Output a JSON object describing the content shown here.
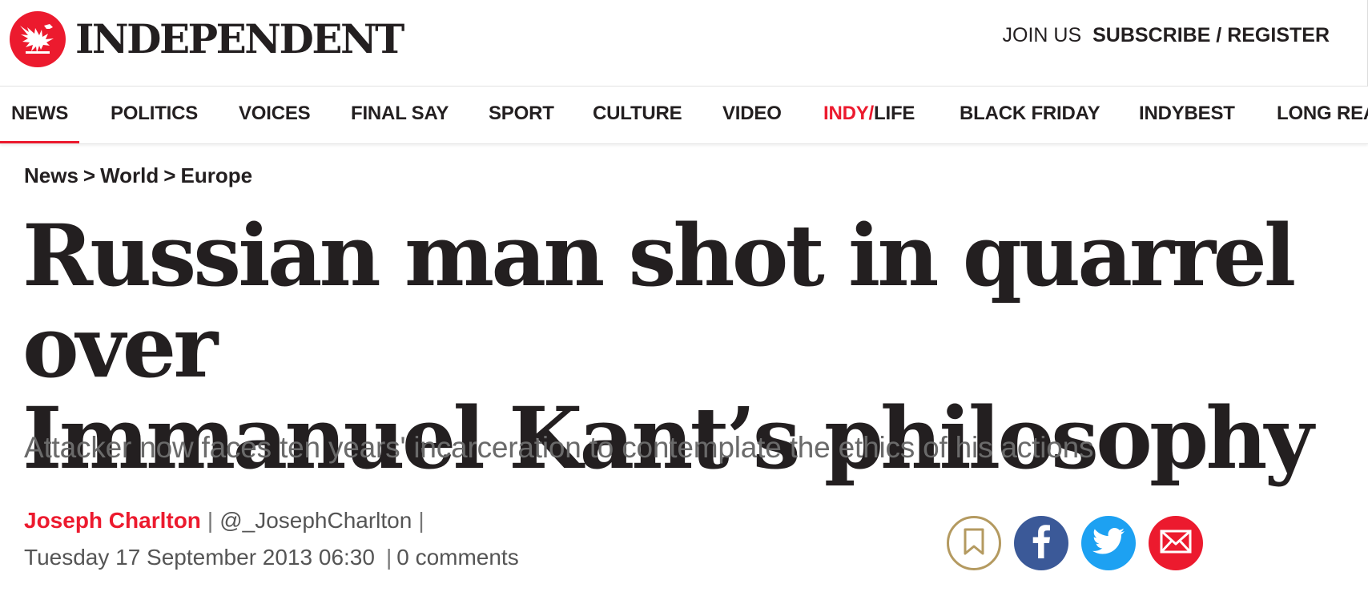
{
  "brand": {
    "name": "INDEPENDENT",
    "logo_icon": "eagle-icon",
    "accent_color": "#ec1a2e"
  },
  "account": {
    "join": "JOIN US",
    "subscribe": "SUBSCRIBE / REGISTER"
  },
  "nav": {
    "items": [
      {
        "label": "NEWS"
      },
      {
        "label": "POLITICS"
      },
      {
        "label": "VOICES"
      },
      {
        "label": "FINAL SAY"
      },
      {
        "label": "SPORT"
      },
      {
        "label": "CULTURE"
      },
      {
        "label": "VIDEO"
      },
      {
        "label_a": "INDY/",
        "label_b": "LIFE"
      },
      {
        "label": "BLACK FRIDAY"
      },
      {
        "label": "INDYBEST"
      },
      {
        "label": "LONG READS"
      }
    ],
    "active": "NEWS"
  },
  "breadcrumb": {
    "items": [
      "News",
      "World",
      "Europe"
    ],
    "separator": ">"
  },
  "article": {
    "headline_line1": "Russian man shot in quarrel over",
    "headline_line2": "Immanuel Kant’s philosophy",
    "standfirst": "Attacker now faces ten years' incarceration to contemplate the ethics of his actions",
    "author": "Joseph Charlton",
    "author_handle": "@_JosephCharlton",
    "pipe": "|",
    "date": "Tuesday 17 September 2013 06:30",
    "comments": "0 comments"
  },
  "share": {
    "icons": [
      "bookmark-icon",
      "facebook-icon",
      "twitter-icon",
      "email-icon"
    ],
    "colors": {
      "bookmark_border": "#b49a60",
      "facebook": "#3b5998",
      "twitter": "#1da1f2",
      "email": "#ec1a2e"
    }
  }
}
